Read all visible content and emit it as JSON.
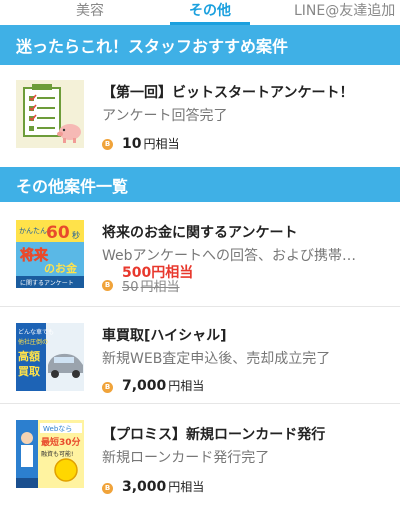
{
  "tabs": [
    {
      "label": "美容"
    },
    {
      "label": "その他"
    },
    {
      "label": "LINE@友達追加"
    }
  ],
  "sections": {
    "recommended": "迷ったらこれ！スタッフおすすめ案件",
    "others": "その他案件一覧"
  },
  "items": [
    {
      "title": "【第一回】ビットスタートアンケート！",
      "desc": "アンケート回答完了",
      "amount": "10",
      "unit": "円相当"
    },
    {
      "title": "将来のお金に関するアンケート",
      "desc": "Webアンケートへの回答、および携帯…",
      "amount": "500円相当",
      "old_amount": "50",
      "unit": "円相当",
      "thumb_lines": [
        "かんたん",
        "60",
        "秒",
        "将来",
        "のお金",
        "に関するアンケート"
      ]
    },
    {
      "title": "車買取[ハイシャル]",
      "desc": "新規WEB査定申込後、売却成立完了",
      "amount": "7,000",
      "unit": "円相当",
      "thumb_lines": [
        "どんな車でも",
        "他社圧倒の",
        "高額",
        "買取"
      ]
    },
    {
      "title": "【プロミス】新規ローンカード発行",
      "desc": "新規ローンカード発行完了",
      "amount": "3,000",
      "unit": "円相当",
      "thumb_lines": [
        "Webなら",
        "最短30分",
        "融資も可能!"
      ]
    }
  ],
  "colors": {
    "accent": "#3fb0e6",
    "tab_active": "#1ba0de",
    "coin": "#f0a33a",
    "sale": "#e8382d"
  }
}
